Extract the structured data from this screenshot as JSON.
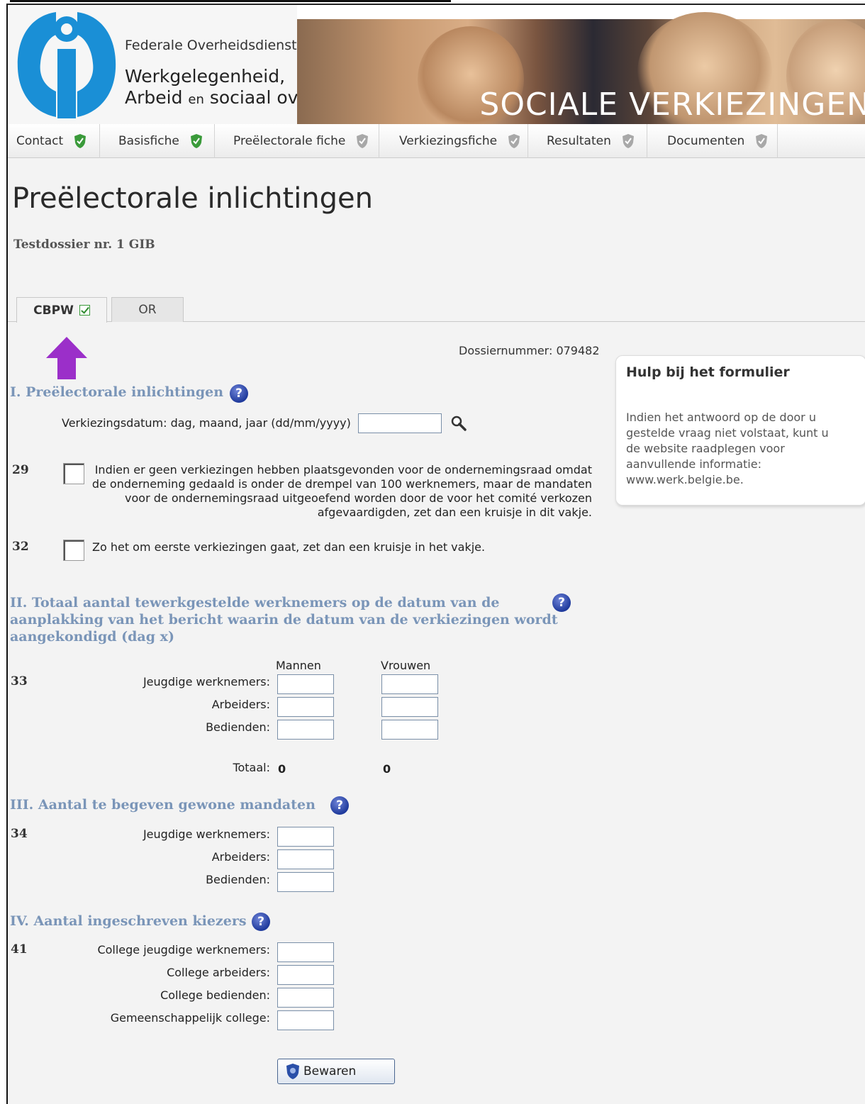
{
  "header": {
    "org_line1": "Federale Overheidsdienst",
    "org_line2": "Werkgelegenheid,",
    "org_line3_a": "Arbeid ",
    "org_line3_en": "en",
    "org_line3_b": " sociaal overleg",
    "banner_title": "SOCIALE VERKIEZINGEN"
  },
  "nav": {
    "items": [
      {
        "label": "Contact",
        "status": "complete"
      },
      {
        "label": "Basisfiche",
        "status": "complete"
      },
      {
        "label": "Preëlectorale fiche",
        "status": "incomplete"
      },
      {
        "label": "Verkiezingsfiche",
        "status": "incomplete"
      },
      {
        "label": "Resultaten",
        "status": "incomplete"
      },
      {
        "label": "Documenten",
        "status": "incomplete"
      }
    ]
  },
  "page": {
    "title": "Preëlectorale inlichtingen",
    "dossier_title": "Testdossier nr. 1 GIB",
    "dossiernummer": "Dossiernummer: 079482"
  },
  "tabs": [
    {
      "label": "CBPW",
      "active": true,
      "checked": true
    },
    {
      "label": "OR",
      "active": false
    }
  ],
  "help": {
    "title": "Hulp bij het formulier",
    "text": "Indien het antwoord op de door u gestelde vraag niet volstaat, kunt u de website raadplegen voor aanvullende informatie: www.werk.belgie.be."
  },
  "section1": {
    "title": "I. Preëlectorale inlichtingen",
    "date_label": "Verkiezingsdatum: dag, maand, jaar (dd/mm/yyyy)",
    "date_value": "",
    "q29_num": "29",
    "q29_text": "Indien er geen verkiezingen hebben plaatsgevonden voor de ondernemingsraad omdat de onderneming gedaald is onder de drempel van 100 werknemers, maar de mandaten voor de ondernemingsraad uitgeoefend worden door de voor het comité verkozen afgevaardigden, zet dan een kruisje in dit vakje.",
    "q32_num": "32",
    "q32_text": "Zo het om eerste verkiezingen gaat, zet dan een kruisje in het vakje."
  },
  "section2": {
    "title_line1": "II. Totaal aantal tewerkgestelde werknemers op de datum van de",
    "title_line2": "aanplakking van het bericht waarin de datum van de verkiezingen wordt",
    "title_line3": "aangekondigd (dag x)",
    "col_men": "Mannen",
    "col_women": "Vrouwen",
    "q_num": "33",
    "rows": [
      "Jeugdige werknemers:",
      "Arbeiders:",
      "Bedienden:"
    ],
    "total_label": "Totaal:",
    "total_men": "0",
    "total_women": "0"
  },
  "section3": {
    "title": "III. Aantal te begeven gewone mandaten",
    "q_num": "34",
    "rows": [
      "Jeugdige werknemers:",
      "Arbeiders:",
      "Bedienden:"
    ]
  },
  "section4": {
    "title": "IV. Aantal ingeschreven kiezers",
    "q_num": "41",
    "rows": [
      "College jeugdige werknemers:",
      "College arbeiders:",
      "College bedienden:",
      "Gemeenschappelijk college:"
    ]
  },
  "actions": {
    "save_label": "Bewaren"
  },
  "colors": {
    "section_title": "#7a95b8",
    "arrow": "#9b2fc9",
    "help_icon": "#1f3a9c",
    "shield_ok": "#3a9a3a",
    "shield_pending": "#9a9a9a"
  }
}
